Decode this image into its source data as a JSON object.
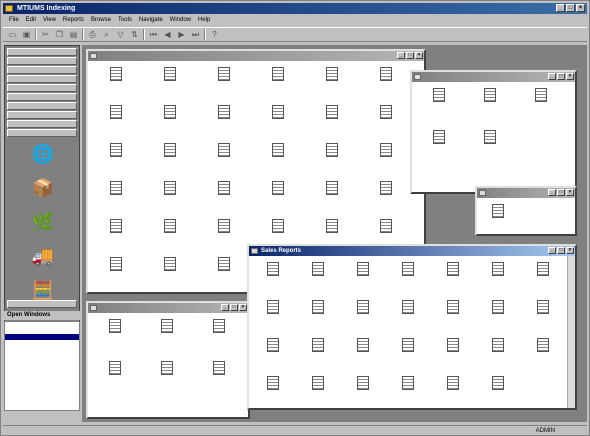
{
  "app": {
    "title": "MTIUMS Indexing"
  },
  "menu": [
    "File",
    "Edit",
    "View",
    "Reports",
    "Browse",
    "Tools",
    "Navigate",
    "Window",
    "Help"
  ],
  "nav": {
    "categories": [
      "",
      "",
      "",
      "",
      "",
      "",
      "",
      "",
      "",
      ""
    ],
    "icons": [
      {
        "label": "",
        "icon": "globe-icon",
        "glyph": "🌐"
      },
      {
        "label": "",
        "icon": "box-icon",
        "glyph": "📦"
      },
      {
        "label": "",
        "icon": "plant-icon",
        "glyph": "🌿"
      },
      {
        "label": "",
        "icon": "truck-icon",
        "glyph": "🚚"
      },
      {
        "label": "",
        "icon": "calculator-icon",
        "glyph": "🧮"
      }
    ],
    "footer_label": ""
  },
  "open_windows": {
    "title": "Open Windows",
    "items": [
      {
        "label": ""
      },
      {
        "label": ""
      },
      {
        "label": ""
      }
    ]
  },
  "windows": {
    "production": {
      "title": "",
      "items": [
        "",
        "",
        "",
        "",
        "",
        "",
        "",
        "",
        "",
        "",
        "",
        "",
        "",
        "",
        "",
        "",
        "",
        "",
        "",
        "",
        "",
        "",
        "",
        "",
        "",
        "",
        "",
        "",
        "",
        "",
        "",
        "",
        "",
        "",
        "",
        ""
      ]
    },
    "engineering": {
      "title": "",
      "items": [
        "",
        "",
        "",
        "",
        ""
      ]
    },
    "inventory": {
      "title": "",
      "items": [
        ""
      ]
    },
    "purchasing": {
      "title": "",
      "items": [
        "",
        "",
        "",
        "",
        "",
        ""
      ]
    },
    "sales": {
      "title": "Sales Reports",
      "items": [
        "",
        "",
        "",
        "",
        "",
        "",
        "",
        "",
        "",
        "",
        "",
        "",
        "",
        "",
        "",
        "",
        "",
        "",
        "",
        "",
        "",
        "",
        "",
        "",
        "",
        "",
        ""
      ]
    }
  },
  "status": {
    "user": "ADMIN",
    "caps": "",
    "num": "",
    "ovr": ""
  }
}
